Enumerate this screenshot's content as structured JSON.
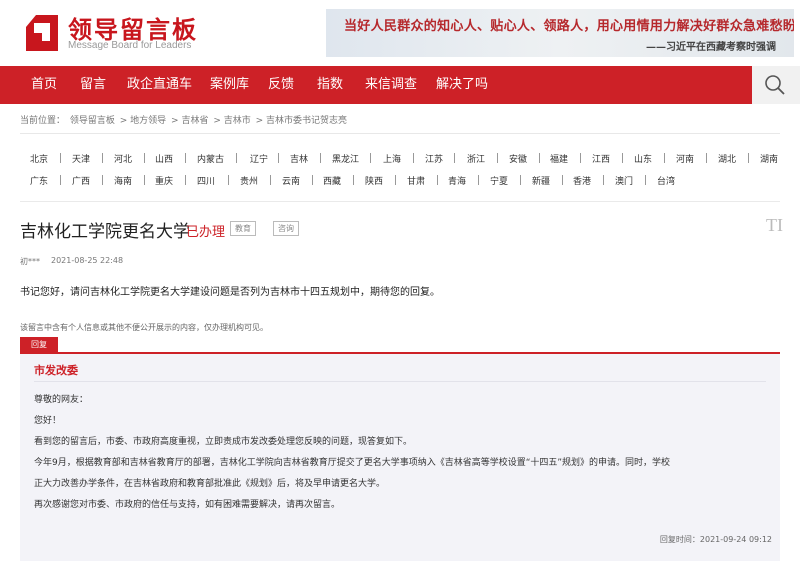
{
  "header": {
    "title": "领导留言板",
    "subtitle": "Message Board for Leaders",
    "banner_text": "当好人民群众的知心人、贴心人、领路人，用心用情用力解决好群众急难愁盼问题。",
    "banner_quote": "——习近平在西藏考察时强调",
    "brand_color": "#cd2127"
  },
  "nav": {
    "items": [
      "首页",
      "留言",
      "政企直通车",
      "案例库",
      "反馈",
      "指数",
      "来信调查",
      "解决了吗"
    ],
    "search_icon": "search-icon"
  },
  "breadcrumb": {
    "prefix": "当前位置：",
    "items": [
      "领导留言板",
      "地方领导",
      "吉林省",
      "吉林市",
      "吉林市委书记贺志亮"
    ]
  },
  "provinces": {
    "row1": [
      "北京",
      "天津",
      "河北",
      "山西",
      "内蒙古",
      "辽宁",
      "吉林",
      "黑龙江",
      "上海",
      "江苏",
      "浙江",
      "安徽",
      "福建",
      "江西",
      "山东",
      "河南",
      "湖北",
      "湖南"
    ],
    "row2": [
      "广东",
      "广西",
      "海南",
      "重庆",
      "四川",
      "贵州",
      "云南",
      "西藏",
      "陕西",
      "甘肃",
      "青海",
      "宁夏",
      "新疆",
      "香港",
      "澳门",
      "台湾"
    ]
  },
  "message": {
    "title": "吉林化工学院更名大学",
    "status": "已办理",
    "tags": [
      "教育",
      "咨询"
    ],
    "font_icon": "TI",
    "author": "初***",
    "time": "2021-08-25 22:48",
    "content": "书记您好，请问吉林化工学院更名大学建设问题是否列为吉林市十四五规划中，期待您的回复。",
    "privacy_note": "该留言中含有个人信息或其他不便公开展示的内容，仅办理机构可见。"
  },
  "reply": {
    "tag": "回复",
    "org": "市发改委",
    "lines": [
      "尊敬的网友：",
      "您好！",
      "看到您的留言后，市委、市政府高度重视，立即责成市发改委处理您反映的问题，现答复如下。",
      "今年9月，根据教育部和吉林省教育厅的部署，吉林化工学院向吉林省教育厅提交了更名大学事项纳入《吉林省高等学校设置“十四五”规划》的申请。同时，学校",
      "正大力改善办学条件，在吉林省政府和教育部批准此《规划》后，将及早申请更名大学。",
      "再次感谢您对市委、市政府的信任与支持，如有困难需要解决，请再次留言。"
    ],
    "time": "回复时间：2021-09-24 09:12"
  }
}
